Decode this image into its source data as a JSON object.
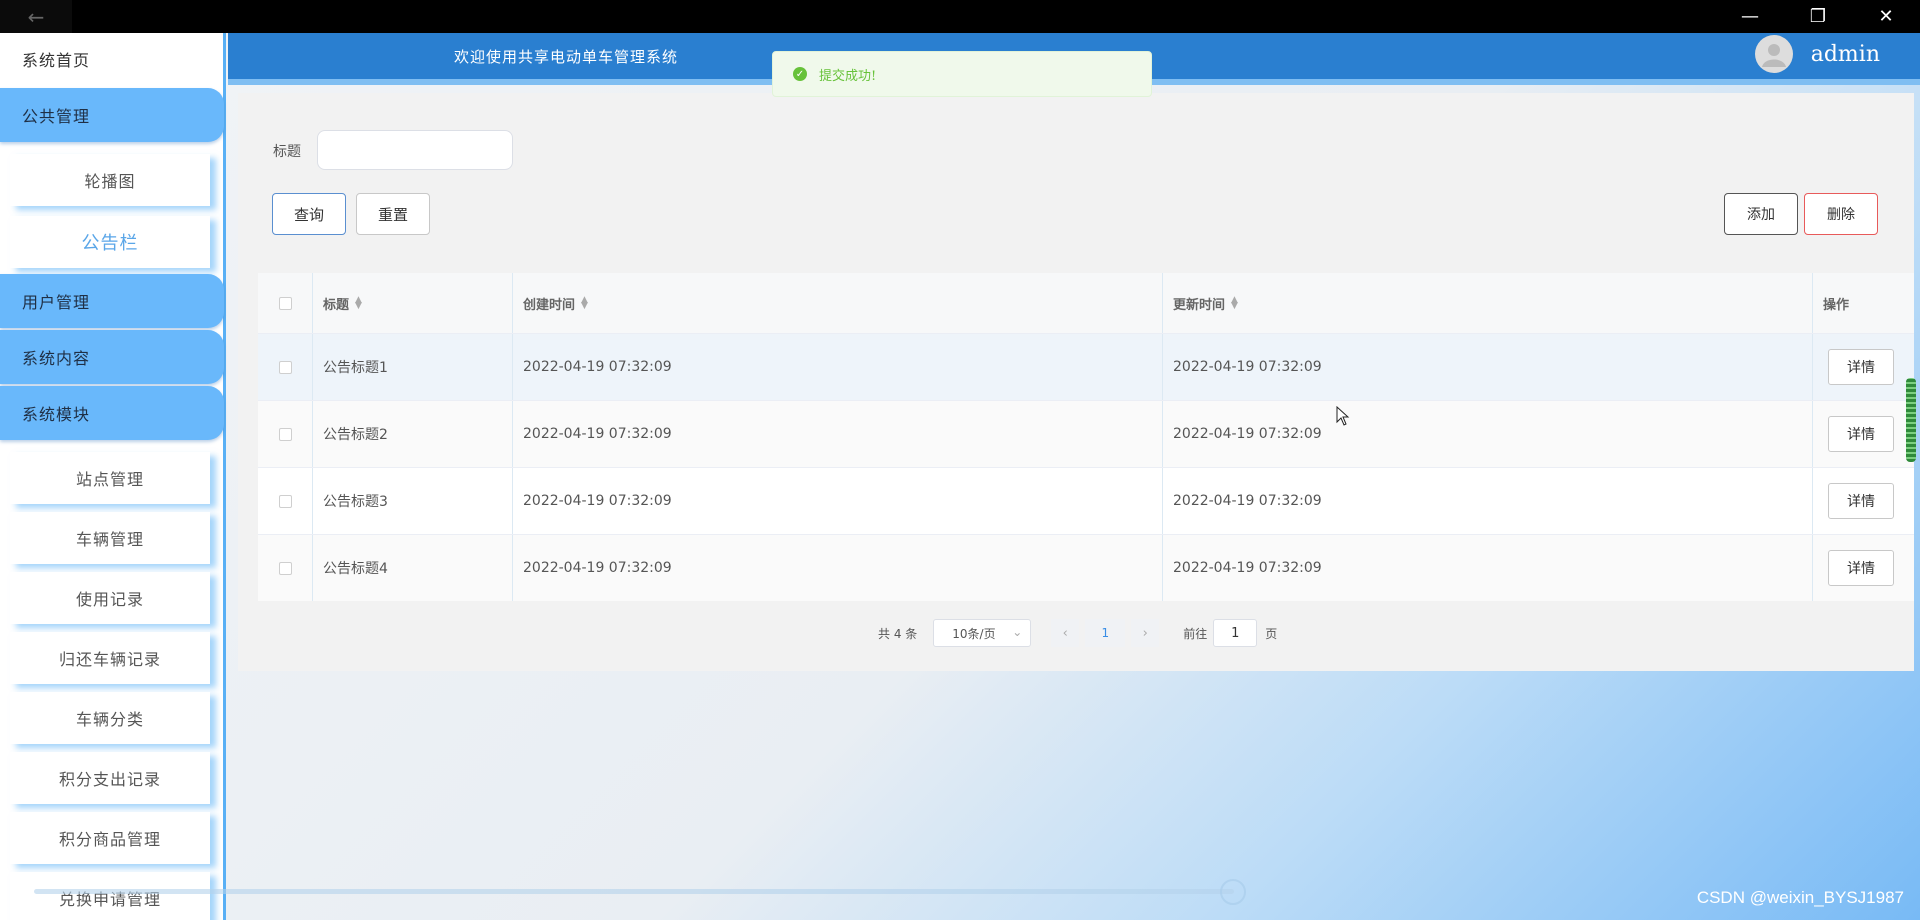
{
  "window": {
    "back_icon": "←",
    "minimize_icon": "—",
    "restore_icon": "❐",
    "close_icon": "✕"
  },
  "sidebar": {
    "home": "系统首页",
    "groups": [
      {
        "label": "公共管理"
      },
      {
        "label": "用户管理"
      },
      {
        "label": "系统内容"
      },
      {
        "label": "系统模块"
      }
    ],
    "public_items": [
      "轮播图",
      "公告栏"
    ],
    "module_items": [
      "站点管理",
      "车辆管理",
      "使用记录",
      "归还车辆记录",
      "车辆分类",
      "积分支出记录",
      "积分商品管理",
      "兑换申请管理"
    ]
  },
  "header": {
    "welcome": "欢迎使用共享电动单车管理系统",
    "username": "admin"
  },
  "toast": {
    "message": "提交成功!",
    "color": "#67c23a"
  },
  "search": {
    "label": "标题",
    "value": "",
    "placeholder": ""
  },
  "toolbar": {
    "query_label": "查询",
    "reset_label": "重置",
    "add_label": "添加",
    "delete_label": "删除"
  },
  "table": {
    "headers": {
      "title": "标题",
      "created": "创建时间",
      "updated": "更新时间",
      "op": "操作"
    },
    "rows": [
      {
        "title": "公告标题1",
        "created": "2022-04-19 07:32:09",
        "updated": "2022-04-19 07:32:09",
        "action": "详情"
      },
      {
        "title": "公告标题2",
        "created": "2022-04-19 07:32:09",
        "updated": "2022-04-19 07:32:09",
        "action": "详情"
      },
      {
        "title": "公告标题3",
        "created": "2022-04-19 07:32:09",
        "updated": "2022-04-19 07:32:09",
        "action": "详情"
      },
      {
        "title": "公告标题4",
        "created": "2022-04-19 07:32:09",
        "updated": "2022-04-19 07:32:09",
        "action": "详情"
      }
    ]
  },
  "pagination": {
    "total": "共 4 条",
    "page_size": "10条/页",
    "prev_icon": "‹",
    "next_icon": "›",
    "current_page": "1",
    "goto_label": "前往",
    "goto_value": "1",
    "page_suffix": "页"
  },
  "watermark": "CSDN @weixin_BYSJ1987",
  "colors": {
    "header": "#2a7fd0",
    "sidebar_group": "#69b8fb",
    "accent": "#59b0f5",
    "delete": "#e85a5a"
  }
}
